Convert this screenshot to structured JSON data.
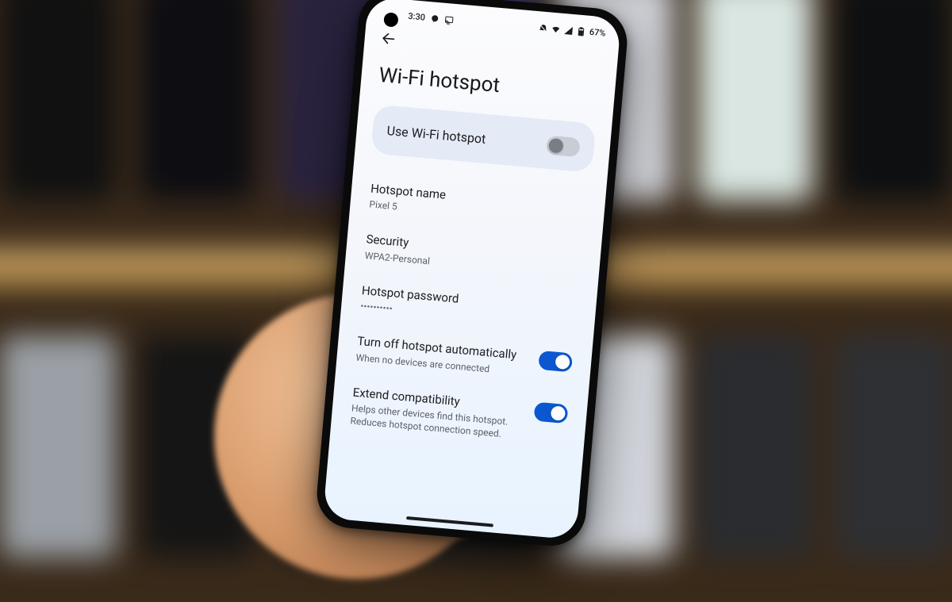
{
  "status_bar": {
    "time": "3:30",
    "battery_text": "67%",
    "left_icons": [
      "messenger-icon",
      "cast-icon"
    ],
    "right_icons": [
      "dnd-icon",
      "wifi-icon",
      "signal-icon",
      "battery-icon"
    ]
  },
  "page": {
    "title": "Wi-Fi hotspot"
  },
  "main_toggle": {
    "label": "Use Wi-Fi hotspot",
    "enabled": false
  },
  "settings": {
    "hotspot_name": {
      "label": "Hotspot name",
      "value": "Pixel 5"
    },
    "security": {
      "label": "Security",
      "value": "WPA2-Personal"
    },
    "hotspot_password": {
      "label": "Hotspot password",
      "value": "••••••••••"
    },
    "auto_off": {
      "label": "Turn off hotspot automatically",
      "description": "When no devices are connected",
      "enabled": true
    },
    "extend_compat": {
      "label": "Extend compatibility",
      "description": "Helps other devices find this hotspot. Reduces hotspot connection speed.",
      "enabled": true
    }
  }
}
